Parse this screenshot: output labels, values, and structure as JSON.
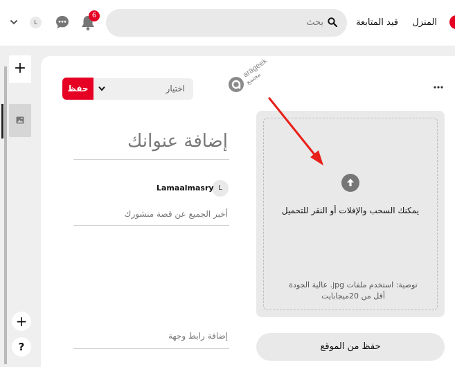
{
  "header": {
    "nav_home": "المنزل",
    "nav_following": "قيد المتابعة",
    "search_placeholder": "بحث",
    "notifications_count": "6",
    "avatar_initial": "L"
  },
  "rail": {
    "add_label": "+",
    "add2_label": "+",
    "help_label": "?"
  },
  "form": {
    "board_select": "اختيار",
    "save_label": "حفظ",
    "title_placeholder": "إضافة عنوانك",
    "user_initial": "L",
    "username": "Lamaalmasry",
    "description_placeholder": "أخبر الجميع عن قصة منشورك",
    "link_placeholder": "إضافة رابط وجهة"
  },
  "upload": {
    "instruction": "يمكنك السحب والإفلات أو النقر للتحميل",
    "hint": "توصية: استخدم ملفات jpg. عالية الجودة أقل من 20ميجابايت",
    "save_from_site": "حفظ من الموقع"
  },
  "watermark": {
    "text_latin": "arageek",
    "text_arabic": "مجتمع"
  },
  "colors": {
    "brand": "#e60023",
    "annotation_arrow": "#e8201a"
  }
}
